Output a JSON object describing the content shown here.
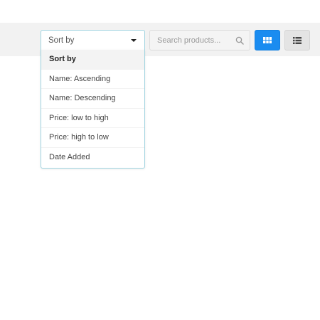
{
  "sort": {
    "selected_label": "Sort by",
    "options": [
      {
        "label": "Sort by"
      },
      {
        "label": "Name: Ascending"
      },
      {
        "label": "Name: Descending"
      },
      {
        "label": "Price: low to high"
      },
      {
        "label": "Price: high to low"
      },
      {
        "label": "Date Added"
      }
    ]
  },
  "search": {
    "placeholder": "Search products...",
    "value": "",
    "icon": "search-icon"
  },
  "view": {
    "grid_icon": "grid-view-icon",
    "list_icon": "list-view-icon",
    "active": "grid"
  },
  "colors": {
    "accent": "#1a8cf0",
    "toolbar_bg": "#f2f2f2",
    "dropdown_border": "#9fd3df"
  }
}
